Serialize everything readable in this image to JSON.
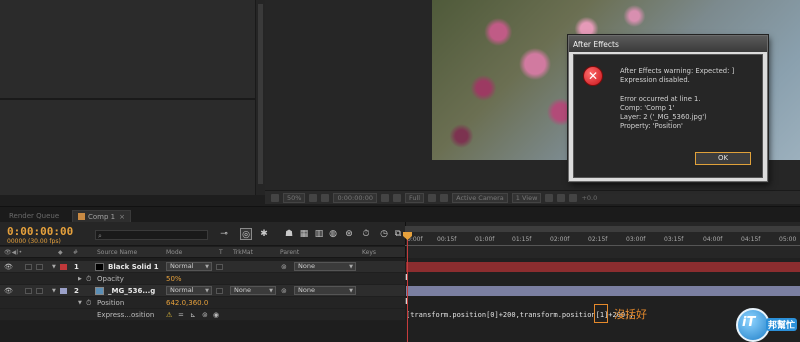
{
  "viewer": {
    "toolbar": [
      "50%",
      "0:00:00:00",
      "Full",
      "Active Camera",
      "1 View",
      "+0.0"
    ]
  },
  "tabs": {
    "render_queue": "Render Queue",
    "comp": "Comp 1"
  },
  "timeline": {
    "timecode": "0:00:00:00",
    "fps": "00000 (30.00 fps)",
    "columns": {
      "num": "#",
      "source": "Source Name",
      "mode": "Mode",
      "t": "T",
      "trkmat": "TrkMat",
      "parent": "Parent",
      "keys": "Keys"
    },
    "ticks": [
      "0:00f",
      "00:15f",
      "01:00f",
      "01:15f",
      "02:00f",
      "02:15f",
      "03:00f",
      "03:15f",
      "04:00f",
      "04:15f",
      "05:00"
    ],
    "layers": [
      {
        "num": "1",
        "name": "Black Solid 1",
        "mode": "Normal",
        "parent": "None",
        "color": "#c0383a"
      },
      {
        "num": "2",
        "name": "_MG_536...g",
        "mode": "Normal",
        "trkmat": "None",
        "parent": "None",
        "color": "#9aa0c8"
      }
    ],
    "props": {
      "opacity_label": "Opacity",
      "opacity_value": "50%",
      "position_label": "Position",
      "position_value": "642.0,360.0",
      "expression_label": "Express...osition",
      "expression_text": "[transform.position[0]+200,transform.position[1]+200];"
    }
  },
  "annotation": "沒括好",
  "dialog": {
    "title": "After Effects",
    "line1": "After Effects warning: Expected: ]",
    "line2": "Expression disabled.",
    "line3": "Error occurred at line 1.",
    "line4": "Comp: 'Comp 1'",
    "line5": "Layer: 2 ('_MG_5360.jpg')",
    "line6": "Property: 'Position'",
    "ok": "OK"
  },
  "logo": {
    "text1": "iT",
    "text2": "邦幫忙"
  }
}
